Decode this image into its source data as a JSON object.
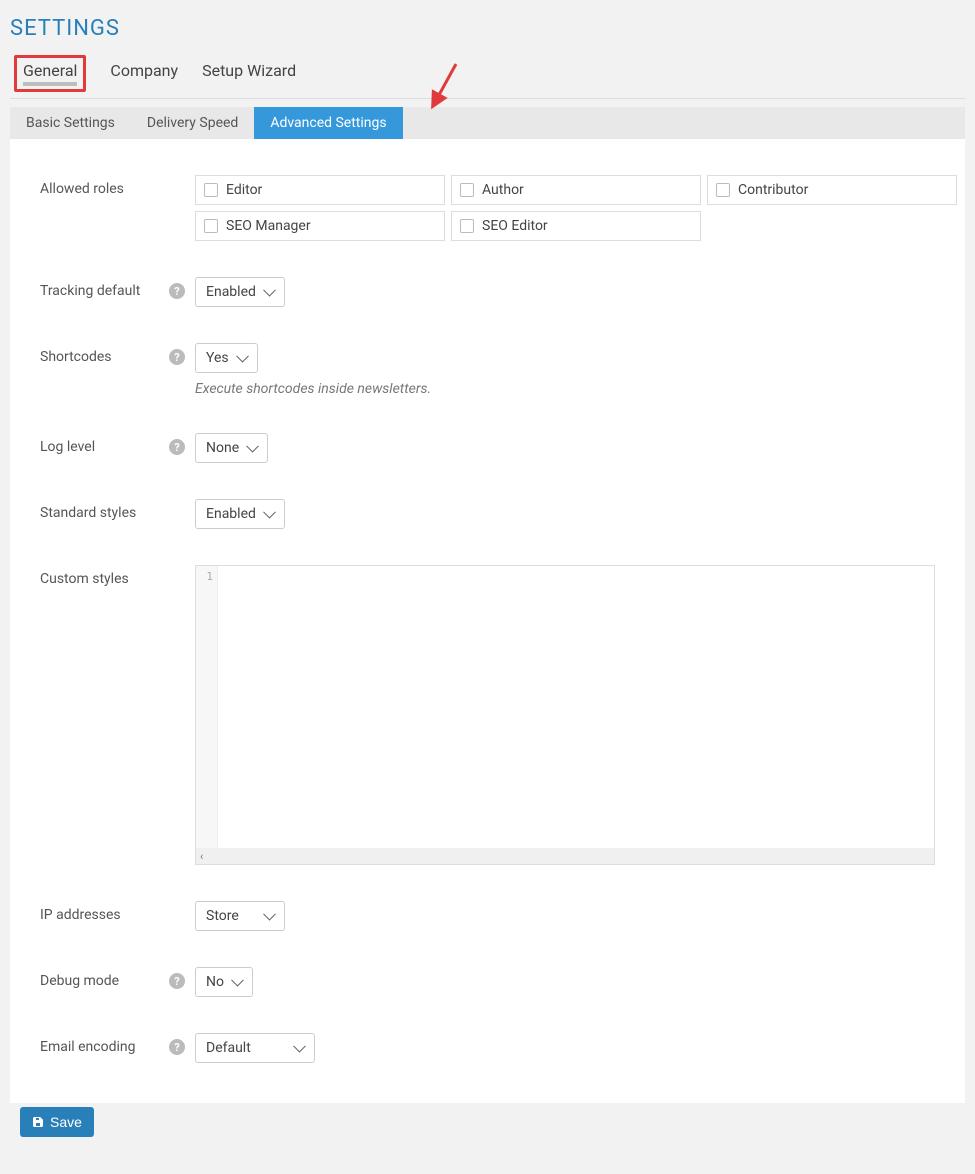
{
  "page": {
    "title": "SETTINGS"
  },
  "mainTabs": {
    "general": "General",
    "company": "Company",
    "setupwizard": "Setup Wizard"
  },
  "subTabs": {
    "basic": "Basic Settings",
    "delivery": "Delivery Speed",
    "advanced": "Advanced Settings"
  },
  "labels": {
    "allowedRoles": "Allowed roles",
    "trackingDefault": "Tracking default",
    "shortcodes": "Shortcodes",
    "logLevel": "Log level",
    "standardStyles": "Standard styles",
    "customStyles": "Custom styles",
    "ipAddresses": "IP addresses",
    "debugMode": "Debug mode",
    "emailEncoding": "Email encoding"
  },
  "roles": {
    "editor": "Editor",
    "author": "Author",
    "contributor": "Contributor",
    "seoManager": "SEO Manager",
    "seoEditor": "SEO Editor"
  },
  "values": {
    "trackingDefault": "Enabled",
    "shortcodes": "Yes",
    "logLevel": "None",
    "standardStyles": "Enabled",
    "ipAddresses": "Store",
    "debugMode": "No",
    "emailEncoding": "Default"
  },
  "help": {
    "shortcodes": "Execute shortcodes inside newsletters."
  },
  "editor": {
    "line1": "1"
  },
  "buttons": {
    "save": "Save"
  }
}
